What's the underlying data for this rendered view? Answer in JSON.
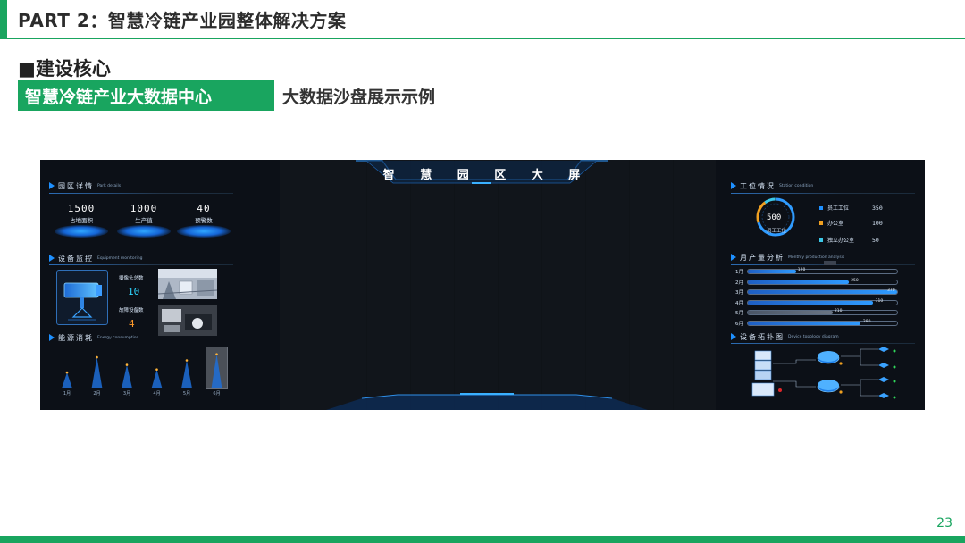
{
  "slide": {
    "title": "PART 2：智慧冷链产业园整体解决方案",
    "section_heading": "■建设核心",
    "tag_primary": "智慧冷链产业大数据中心",
    "tag_secondary": "大数据沙盘展示示例",
    "page_number": "23",
    "accent_color": "#19a55f"
  },
  "dashboard": {
    "title": "智 慧 园 区 大 屏",
    "park": {
      "title_cn": "园区详情",
      "title_en": "Park details",
      "stats": [
        {
          "value": "1500",
          "label": "占地面积"
        },
        {
          "value": "1000",
          "label": "生产值"
        },
        {
          "value": "40",
          "label": "预警数"
        }
      ]
    },
    "equipment": {
      "title_cn": "设备监控",
      "title_en": "Equipment monitoring",
      "camera_label": "摄像头总数",
      "camera_value": "10",
      "fault_label": "故障设备数",
      "fault_value": "4",
      "camera_icon": "surveillance-camera-icon"
    },
    "energy": {
      "title_cn": "能源消耗",
      "title_en": "Energy consumption",
      "months": [
        "1月",
        "2月",
        "3月",
        "4月",
        "5月",
        "6月"
      ],
      "relative_levels": [
        0.35,
        0.85,
        0.6,
        0.45,
        0.75,
        0.95
      ]
    },
    "station": {
      "title_cn": "工位情况",
      "title_en": "Station condition",
      "total_value": "500",
      "total_label": "员工工位",
      "legend": [
        {
          "name": "员工工位",
          "value": "350",
          "color": "#1e90ff"
        },
        {
          "name": "办公室",
          "value": "100",
          "color": "#f0a020"
        },
        {
          "name": "独立办公室",
          "value": "50",
          "color": "#3cc8e8"
        }
      ]
    },
    "production": {
      "title_cn": "月产量分析",
      "title_en": "Monthly production analysis",
      "max_value": 370,
      "rows": [
        {
          "month": "1月",
          "value": 120,
          "label": "120"
        },
        {
          "month": "2月",
          "value": 250,
          "label": "250"
        },
        {
          "month": "3月",
          "value": 370,
          "label": "370"
        },
        {
          "month": "4月",
          "value": 310,
          "label": "310"
        },
        {
          "month": "5月",
          "value": 210,
          "label": "210"
        },
        {
          "month": "6月",
          "value": 280,
          "label": "280"
        }
      ]
    },
    "topology": {
      "title_cn": "设备拓扑图",
      "title_en": "Device topology diagram",
      "server_icon": "server-icon",
      "router_icon": "router-icon",
      "node_icon": "network-node-icon"
    }
  }
}
